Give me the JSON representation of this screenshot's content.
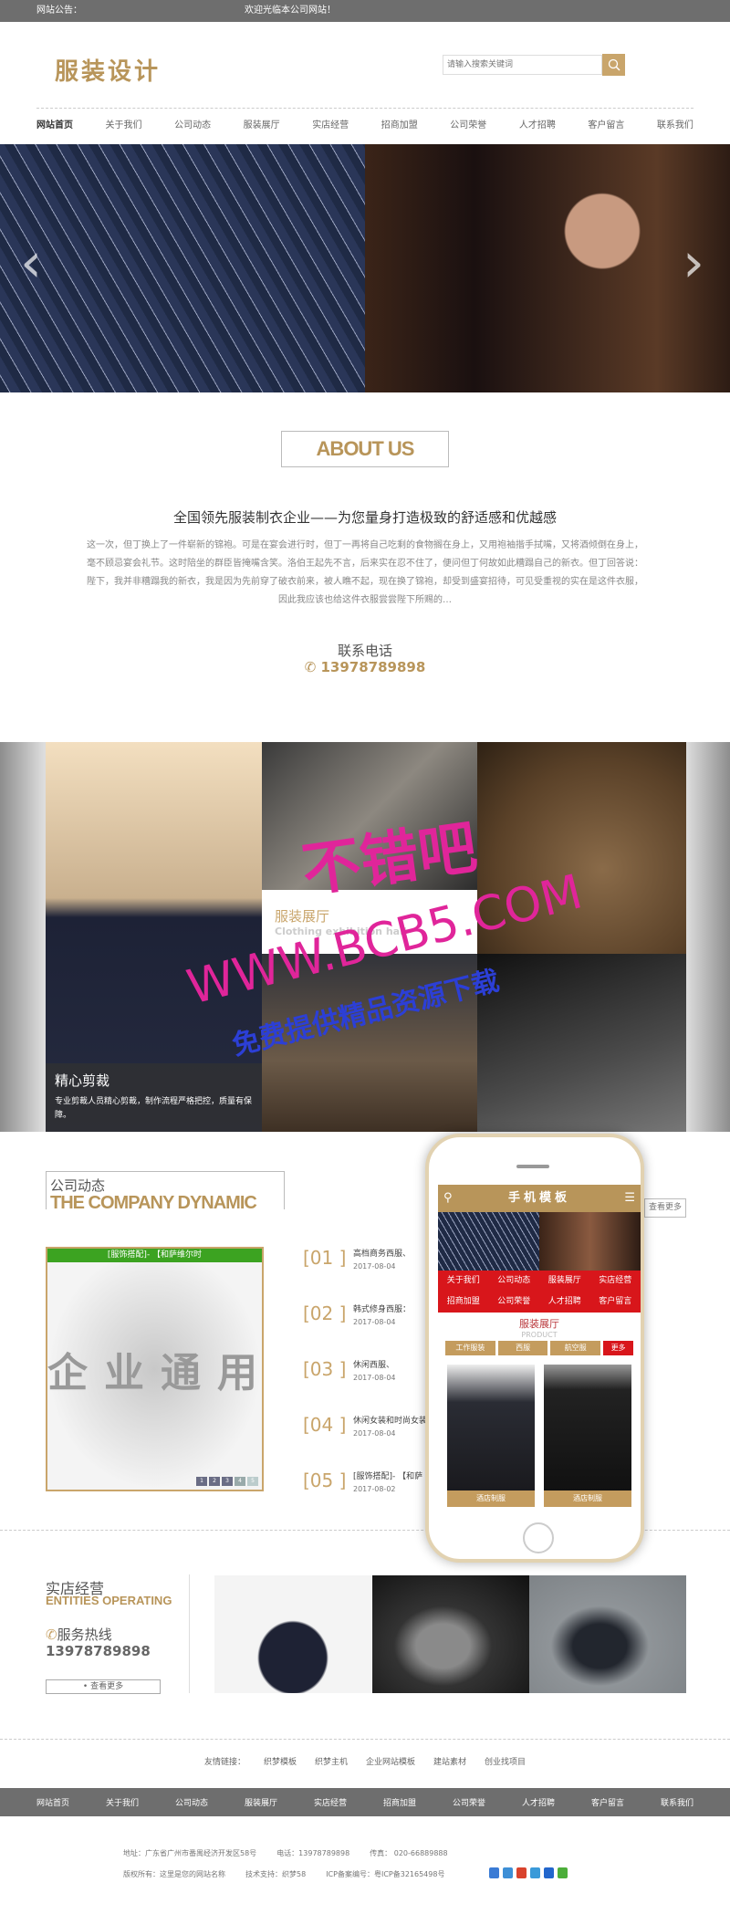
{
  "topbar": {
    "notice_label": "网站公告：",
    "notice_text": "欢迎光临本公司网站！"
  },
  "header": {
    "logo": "服装设计",
    "search_placeholder": "请输入搜索关键词"
  },
  "nav": [
    "网站首页",
    "关于我们",
    "公司动态",
    "服装展厅",
    "实店经营",
    "招商加盟",
    "公司荣誉",
    "人才招聘",
    "客户留言",
    "联系我们"
  ],
  "about": {
    "title": "ABOUT US",
    "subtitle": "全国领先服装制衣企业——为您量身打造极致的舒适感和优越感",
    "body": "这一次，但丁换上了一件崭新的锦袍。可是在宴会进行时，但丁一再将自己吃剩的食物搁在身上，又用袍袖揩手拭嘴，又将酒倾倒在身上，毫不顾忌宴会礼节。这时陪坐的群臣皆掩嘴含笑。洛伯王起先不言，后来实在忍不住了，便问但丁何故如此糟蹋自己的新衣。但丁回答说：陛下，我并非糟蹋我的新衣，我是因为先前穿了破衣前来，被人瞧不起，现在换了锦袍，却受到盛宴招待，可见受重视的实在是这件衣服，因此我应该也给这件衣服尝尝陛下所赐的…",
    "contact_label": "联系电话",
    "phone": "13978789898"
  },
  "gallery": {
    "center_title": "服装展厅",
    "center_subtitle": "Clothing exhibition hall",
    "caption_title": "精心剪裁",
    "caption_text": "专业剪裁人员精心剪裁，制作流程严格把控，质量有保障。"
  },
  "watermark": {
    "line1": "不错吧",
    "line2": "WWW.BCB5.COM",
    "line3": "免费提供精品资源下载"
  },
  "dynamic": {
    "title_zh": "公司动态",
    "title_en": "THE COMPANY DYNAMIC",
    "more": "查看更多",
    "slide_title": "[服饰搭配]- 【和萨维尔时",
    "slide_text": "企业通用",
    "slide_pages": [
      "1",
      "2",
      "3",
      "4",
      "5"
    ],
    "news": [
      {
        "num": "[01 ]",
        "title": "高档商务西服、",
        "date": "2017-08-04"
      },
      {
        "num": "[02 ]",
        "title": "韩式修身西服：",
        "date": "2017-08-04"
      },
      {
        "num": "[03 ]",
        "title": "休闲西服、",
        "date": "2017-08-04"
      },
      {
        "num": "[04 ]",
        "title": "休闲女装和时尚女装",
        "date": "2017-08-04"
      },
      {
        "num": "[05 ]",
        "title": "[服饰搭配]- 【和萨",
        "date": "2017-08-02"
      }
    ]
  },
  "mobile": {
    "title": "手机模板",
    "menu": [
      "关于我们",
      "公司动态",
      "服装展厅",
      "实店经营",
      "招商加盟",
      "公司荣誉",
      "人才招聘",
      "客户留言"
    ],
    "section_title": "服装展厅",
    "section_sub": "PRODUCT",
    "tabs": [
      "工作服装",
      "西服",
      "航空服",
      "更多"
    ],
    "products": [
      "酒店制服",
      "酒店制服"
    ]
  },
  "entities": {
    "title_zh": "实店经营",
    "title_en": "ENTITIES OPERATING",
    "hotline_label": "服务热线",
    "hotline": "13978789898",
    "more": "• 查看更多"
  },
  "footer": {
    "links_label": "友情链接：",
    "links": [
      "织梦模板",
      "织梦主机",
      "企业网站模板",
      "建站素材",
      "创业找项目"
    ],
    "nav": [
      "网站首页",
      "关于我们",
      "公司动态",
      "服装展厅",
      "实店经营",
      "招商加盟",
      "公司荣誉",
      "人才招聘",
      "客户留言",
      "联系我们"
    ],
    "address": "地址：广东省广州市番禺经济开发区58号",
    "tel": "电话：13978789898",
    "fax": "传真： 020-66889888",
    "copyright": "版权所有：这里是您的网站名称",
    "support": "技术支持：织梦58",
    "icp": "ICP备案编号：粤ICP备32165498号",
    "social_colors": [
      "#3a7bd5",
      "#3d8fd6",
      "#d9432c",
      "#3a9ad9",
      "#2266cc",
      "#4cae3a"
    ]
  },
  "colors": {
    "accent": "#b8955a",
    "topbar": "#6e6e6e",
    "mobile_red": "#d8161b",
    "slide_green": "#3ca321"
  }
}
